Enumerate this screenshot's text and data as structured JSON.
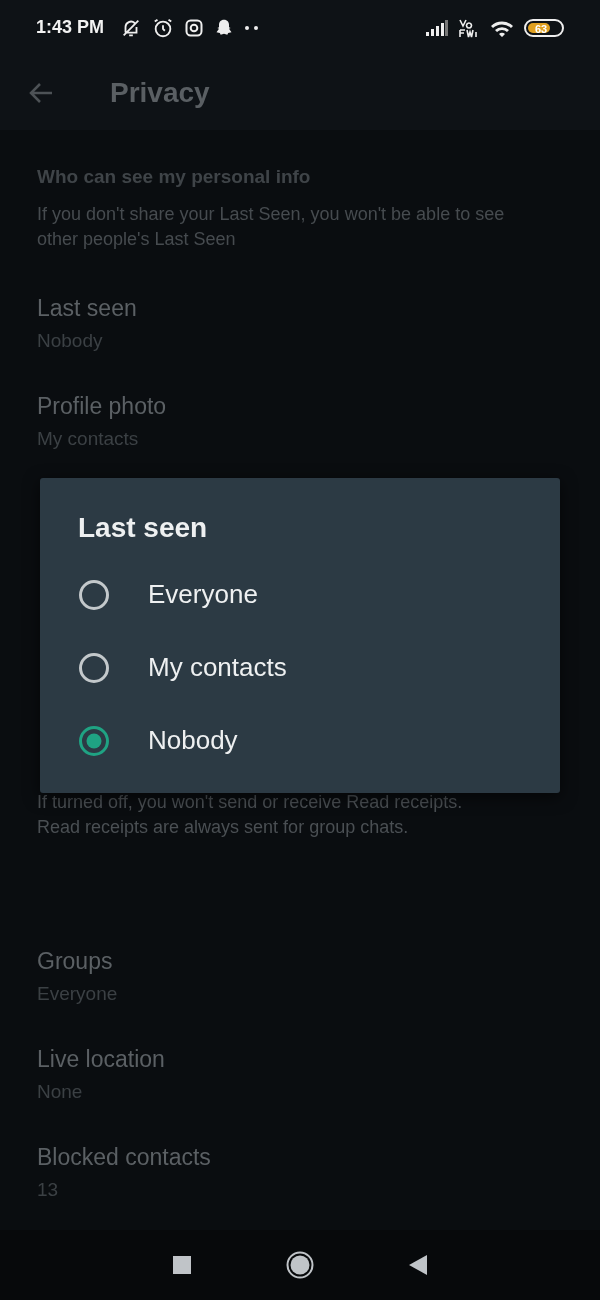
{
  "status_bar": {
    "time": "1:43 PM",
    "battery": "63"
  },
  "app_bar": {
    "title": "Privacy"
  },
  "section": {
    "heading": "Who can see my personal info",
    "note": "If you don't share your Last Seen, you won't be able to see other people's Last Seen"
  },
  "items": [
    {
      "title": "Last seen",
      "value": "Nobody"
    },
    {
      "title": "Profile photo",
      "value": "My contacts"
    }
  ],
  "read_receipts_note": "If turned off, you won't send or receive Read receipts. Read receipts are always sent for group chats.",
  "more_items": [
    {
      "title": "Groups",
      "value": "Everyone"
    },
    {
      "title": "Live location",
      "value": "None"
    },
    {
      "title": "Blocked contacts",
      "value": "13"
    }
  ],
  "dialog": {
    "title": "Last seen",
    "options": [
      {
        "label": "Everyone",
        "selected": false
      },
      {
        "label": "My contacts",
        "selected": false
      },
      {
        "label": "Nobody",
        "selected": true
      }
    ]
  }
}
